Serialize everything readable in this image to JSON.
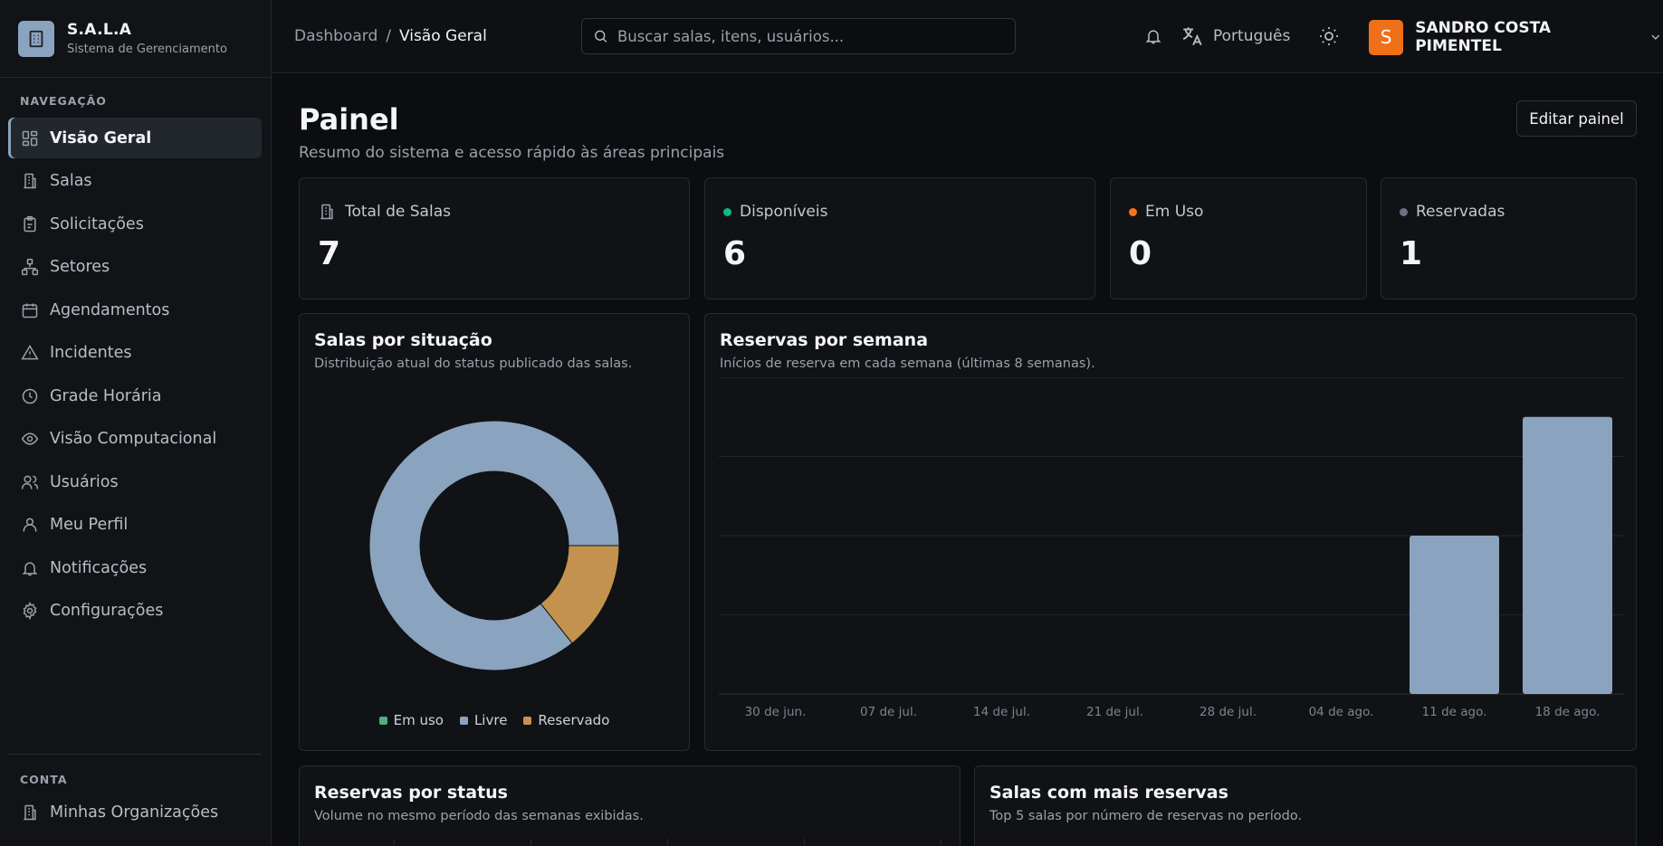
{
  "brand": {
    "name": "S.A.L.A",
    "subtitle": "Sistema de Gerenciamento"
  },
  "sidebar": {
    "nav_heading": "NAVEGAÇÃO",
    "items": [
      {
        "label": "Visão Geral",
        "icon": "grid-icon",
        "active": true
      },
      {
        "label": "Salas",
        "icon": "building-icon"
      },
      {
        "label": "Solicitações",
        "icon": "clipboard-icon"
      },
      {
        "label": "Setores",
        "icon": "network-icon"
      },
      {
        "label": "Agendamentos",
        "icon": "calendar-icon"
      },
      {
        "label": "Incidentes",
        "icon": "warning-icon"
      },
      {
        "label": "Grade Horária",
        "icon": "clock-icon"
      },
      {
        "label": "Visão Computacional",
        "icon": "eye-icon"
      },
      {
        "label": "Usuários",
        "icon": "users-icon"
      },
      {
        "label": "Meu Perfil",
        "icon": "user-icon"
      },
      {
        "label": "Notificações",
        "icon": "bell-icon"
      },
      {
        "label": "Configurações",
        "icon": "gear-icon"
      }
    ],
    "account_heading": "CONTA",
    "account_items": [
      {
        "label": "Minhas Organizações",
        "icon": "building-icon"
      }
    ]
  },
  "header": {
    "breadcrumb_root": "Dashboard",
    "breadcrumb_sep": "/",
    "breadcrumb_current": "Visão Geral",
    "search_placeholder": "Buscar salas, itens, usuários...",
    "language": "Português",
    "user_initial": "S",
    "user_name": "SANDRO COSTA PIMENTEL"
  },
  "page": {
    "title": "Painel",
    "subtitle": "Resumo do sistema e acesso rápido às áreas principais",
    "edit_button": "Editar painel"
  },
  "stats": [
    {
      "label": "Total de Salas",
      "value": "7",
      "icon": "building-icon"
    },
    {
      "label": "Disponíveis",
      "value": "6",
      "dot_color": "#10b981"
    },
    {
      "label": "Em Uso",
      "value": "0",
      "dot_color": "#f97316"
    },
    {
      "label": "Reservadas",
      "value": "1",
      "dot_color": "#6b7280"
    }
  ],
  "colors": {
    "livre": "#8aa3be",
    "reservado": "#c4924f",
    "em_uso": "#4caf7d",
    "bar": "#8aa3be"
  },
  "status_card": {
    "title": "Salas por situação",
    "subtitle": "Distribuição atual do status publicado das salas."
  },
  "weekly_card": {
    "title": "Reservas por semana",
    "subtitle": "Inícios de reserva em cada semana (últimas 8 semanas)."
  },
  "bottom_left": {
    "title": "Reservas por status",
    "subtitle": "Volume no mesmo período das semanas exibidas."
  },
  "bottom_right": {
    "title": "Salas com mais reservas",
    "subtitle": "Top 5 salas por número de reservas no período."
  },
  "chart_data": [
    {
      "type": "pie",
      "categories": [
        "Em uso",
        "Livre",
        "Reservado"
      ],
      "values": [
        0,
        6,
        1
      ],
      "legend_position": "bottom"
    },
    {
      "type": "bar",
      "categories": [
        "30 de jun.",
        "07 de jul.",
        "14 de jul.",
        "21 de jul.",
        "28 de jul.",
        "04 de ago.",
        "11 de ago.",
        "18 de ago."
      ],
      "values": [
        0,
        0,
        0,
        0,
        0,
        0,
        2,
        3.5
      ],
      "ylim": [
        0,
        4
      ],
      "grid": true
    }
  ]
}
